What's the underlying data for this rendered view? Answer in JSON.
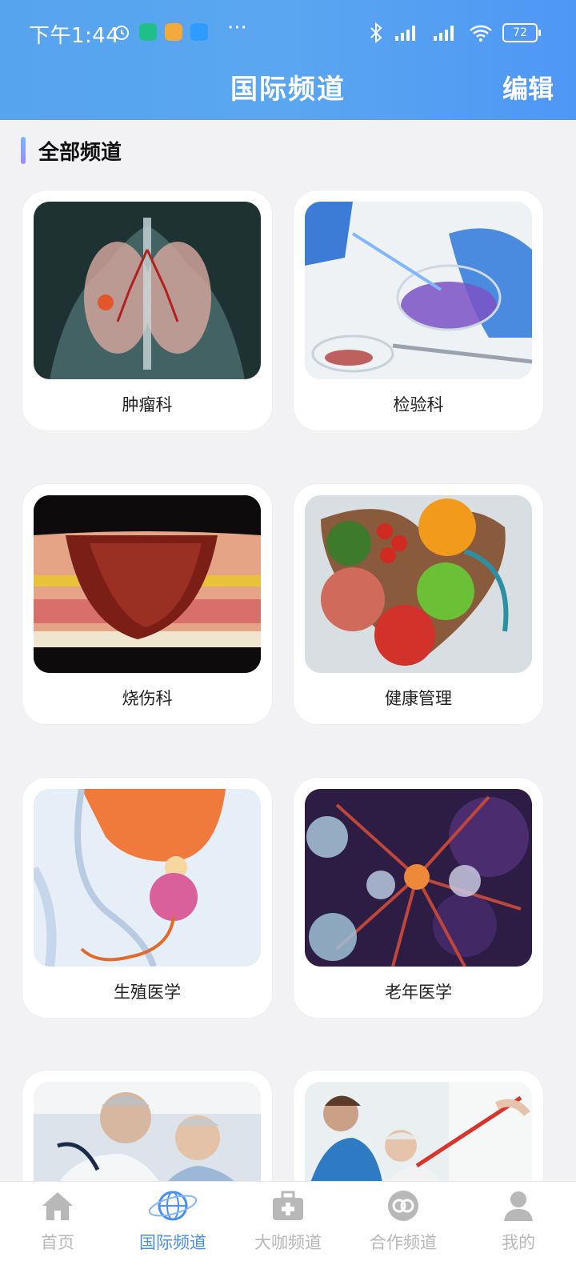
{
  "status_bar": {
    "time": "下午1:44",
    "battery": "72",
    "overflow": "···"
  },
  "header": {
    "title": "国际频道",
    "edit_label": "编辑"
  },
  "section": {
    "title": "全部频道"
  },
  "channels": [
    {
      "label": "肿瘤科"
    },
    {
      "label": "检验科"
    },
    {
      "label": "烧伤科"
    },
    {
      "label": "健康管理"
    },
    {
      "label": "生殖医学"
    },
    {
      "label": "老年医学"
    },
    {
      "label": ""
    },
    {
      "label": ""
    }
  ],
  "bottom_nav": [
    {
      "label": "首页"
    },
    {
      "label": "国际频道"
    },
    {
      "label": "大咖频道"
    },
    {
      "label": "合作频道"
    },
    {
      "label": "我的"
    }
  ],
  "colors": {
    "accent": "#4a8ff0",
    "header_gradient_start": "#57a4ee",
    "inactive": "#b8b8b8"
  }
}
